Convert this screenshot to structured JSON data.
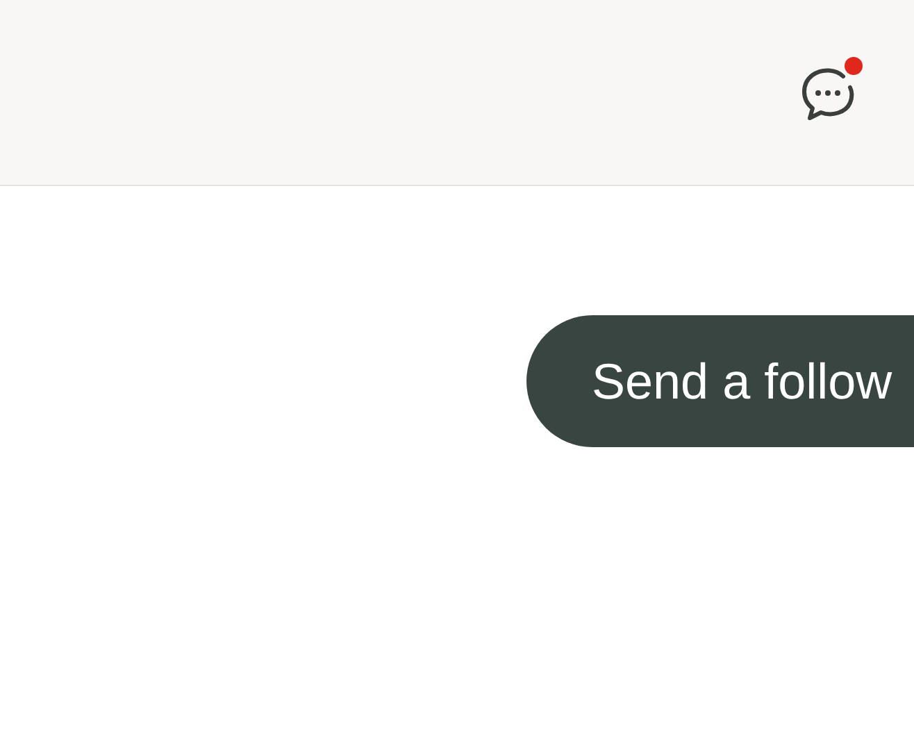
{
  "header": {
    "chat": {
      "unread": true
    }
  },
  "action_button": {
    "label": "Send a follow"
  }
}
